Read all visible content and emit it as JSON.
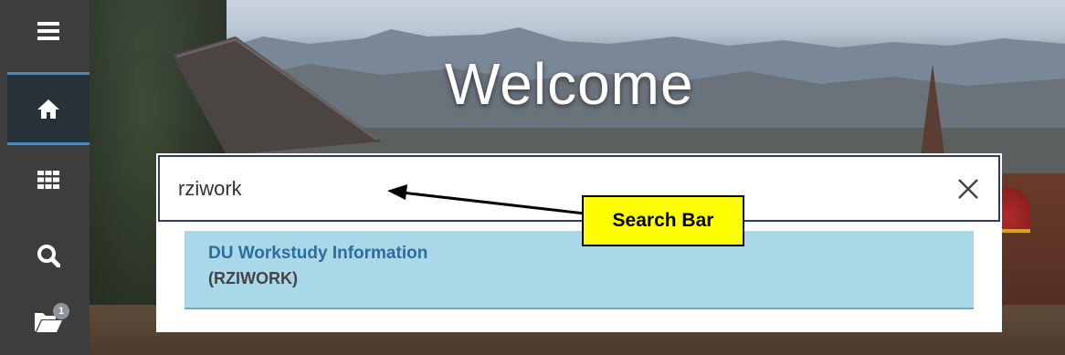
{
  "welcome": {
    "title": "Welcome"
  },
  "sidebar": {
    "items": [
      {
        "icon": "menu-icon"
      },
      {
        "icon": "home-icon",
        "active": true
      },
      {
        "icon": "grid-icon"
      },
      {
        "icon": "search-icon"
      },
      {
        "icon": "folder-icon",
        "badge": "1"
      }
    ]
  },
  "search": {
    "value": "rziwork"
  },
  "suggestions": [
    {
      "title": "DU Workstudy Information",
      "code": "(RZIWORK)"
    }
  ],
  "annotation": {
    "label": "Search Bar"
  },
  "colors": {
    "sidebar_bg": "#3d3e3c",
    "active_nav_bg": "#26313a",
    "active_nav_border": "#4f88b8",
    "suggestion_bg": "#a9d8e8",
    "suggestion_title": "#2d6c9e",
    "callout_bg": "#ffff00",
    "search_border": "#2f3d63"
  }
}
